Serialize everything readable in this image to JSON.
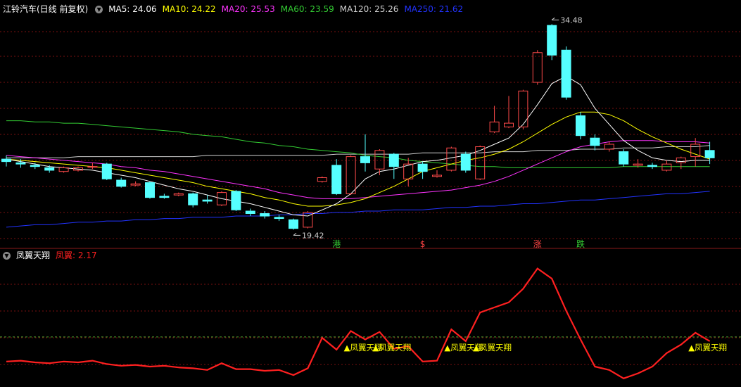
{
  "main_header": {
    "title": "江铃汽车(日线 前复权)",
    "ma": [
      {
        "label": "MA5: 24.06",
        "color": "#ffffff"
      },
      {
        "label": "MA10: 24.22",
        "color": "#ffff00"
      },
      {
        "label": "MA20: 25.53",
        "color": "#ff33ff"
      },
      {
        "label": "MA60: 23.59",
        "color": "#33cc33"
      },
      {
        "label": "MA120: 25.26",
        "color": "#cfcfcf"
      },
      {
        "label": "MA250: 21.62",
        "color": "#2233ff"
      }
    ]
  },
  "sub_header": {
    "title": "凤翼天翔",
    "value_label": "凤翼: 2.17",
    "value_color": "#ff2020"
  },
  "colors": {
    "up": "#ff4a4a",
    "down": "#55ffff",
    "ma5": "#ffffff",
    "ma10": "#ffff00",
    "ma20": "#ff33ff",
    "ma60": "#33cc33",
    "ma120": "#cfcfcf",
    "ma250": "#2233ff",
    "grid": "#7a1010",
    "signal": "#ffff00",
    "indicator": "#ff2020",
    "threshold": "#55aa33"
  },
  "chart_data": [
    {
      "type": "candlestick",
      "title": "江铃汽车(日线 前复权)",
      "ylim": [
        17.5,
        35.8
      ],
      "candles": [
        {
          "o": 24.2,
          "c": 24.0,
          "h": 24.5,
          "l": 23.6
        },
        {
          "o": 23.9,
          "c": 23.8,
          "h": 24.2,
          "l": 23.5
        },
        {
          "o": 23.7,
          "c": 23.6,
          "h": 23.9,
          "l": 23.4
        },
        {
          "o": 23.5,
          "c": 23.3,
          "h": 23.7,
          "l": 23.1
        },
        {
          "o": 23.2,
          "c": 23.5,
          "h": 23.6,
          "l": 23.1
        },
        {
          "o": 23.3,
          "c": 23.5,
          "h": 23.6,
          "l": 23.2
        },
        {
          "o": 23.6,
          "c": 23.6,
          "h": 23.9,
          "l": 23.4
        },
        {
          "o": 23.8,
          "c": 22.6,
          "h": 23.9,
          "l": 22.5
        },
        {
          "o": 22.5,
          "c": 22.0,
          "h": 22.7,
          "l": 21.9
        },
        {
          "o": 22.1,
          "c": 22.2,
          "h": 22.4,
          "l": 22.0
        },
        {
          "o": 22.3,
          "c": 21.1,
          "h": 22.4,
          "l": 21.0
        },
        {
          "o": 21.2,
          "c": 21.1,
          "h": 21.4,
          "l": 21.0
        },
        {
          "o": 21.3,
          "c": 21.4,
          "h": 21.5,
          "l": 21.2
        },
        {
          "o": 21.4,
          "c": 20.5,
          "h": 21.5,
          "l": 20.3
        },
        {
          "o": 20.9,
          "c": 20.8,
          "h": 21.3,
          "l": 20.6
        },
        {
          "o": 20.5,
          "c": 21.5,
          "h": 21.6,
          "l": 20.4
        },
        {
          "o": 21.6,
          "c": 20.1,
          "h": 21.7,
          "l": 20.0
        },
        {
          "o": 20.0,
          "c": 19.8,
          "h": 20.2,
          "l": 19.6
        },
        {
          "o": 19.8,
          "c": 19.6,
          "h": 20.0,
          "l": 19.4
        },
        {
          "o": 19.5,
          "c": 19.4,
          "h": 19.7,
          "l": 19.2
        },
        {
          "o": 19.3,
          "c": 18.6,
          "h": 19.4,
          "l": 18.5
        },
        {
          "o": 18.7,
          "c": 19.9,
          "h": 20.0,
          "l": 18.6
        },
        {
          "o": 22.4,
          "c": 22.7,
          "h": 22.8,
          "l": 22.3
        },
        {
          "o": 23.7,
          "c": 21.4,
          "h": 24.2,
          "l": 21.3
        },
        {
          "o": 21.4,
          "c": 24.4,
          "h": 24.5,
          "l": 21.3
        },
        {
          "o": 24.4,
          "c": 23.9,
          "h": 26.2,
          "l": 23.2
        },
        {
          "o": 23.4,
          "c": 24.9,
          "h": 25.0,
          "l": 22.9
        },
        {
          "o": 24.6,
          "c": 23.6,
          "h": 24.7,
          "l": 22.6
        },
        {
          "o": 22.6,
          "c": 23.8,
          "h": 24.3,
          "l": 22.0
        },
        {
          "o": 23.8,
          "c": 23.2,
          "h": 24.0,
          "l": 22.6
        },
        {
          "o": 22.8,
          "c": 22.9,
          "h": 23.3,
          "l": 22.7
        },
        {
          "o": 23.3,
          "c": 25.1,
          "h": 25.2,
          "l": 23.2
        },
        {
          "o": 24.6,
          "c": 23.3,
          "h": 24.8,
          "l": 23.1
        },
        {
          "o": 22.6,
          "c": 25.2,
          "h": 25.3,
          "l": 22.5
        },
        {
          "o": 26.4,
          "c": 27.2,
          "h": 28.5,
          "l": 26.3
        },
        {
          "o": 26.8,
          "c": 27.1,
          "h": 29.3,
          "l": 26.7
        },
        {
          "o": 26.8,
          "c": 29.7,
          "h": 29.8,
          "l": 26.6
        },
        {
          "o": 30.4,
          "c": 32.8,
          "h": 33.0,
          "l": 30.2
        },
        {
          "o": 35.0,
          "c": 32.6,
          "h": 35.1,
          "l": 32.2
        },
        {
          "o": 33.0,
          "c": 29.2,
          "h": 33.3,
          "l": 29.0
        },
        {
          "o": 27.7,
          "c": 26.1,
          "h": 28.0,
          "l": 25.8
        },
        {
          "o": 25.9,
          "c": 25.3,
          "h": 26.2,
          "l": 24.9
        },
        {
          "o": 25.0,
          "c": 25.4,
          "h": 25.6,
          "l": 24.8
        },
        {
          "o": 24.8,
          "c": 23.8,
          "h": 25.0,
          "l": 23.6
        },
        {
          "o": 23.7,
          "c": 23.8,
          "h": 24.2,
          "l": 23.5
        },
        {
          "o": 23.7,
          "c": 23.6,
          "h": 23.9,
          "l": 23.4
        },
        {
          "o": 23.3,
          "c": 23.8,
          "h": 24.1,
          "l": 23.2
        },
        {
          "o": 23.9,
          "c": 24.3,
          "h": 24.4,
          "l": 23.4
        },
        {
          "o": 24.4,
          "c": 25.4,
          "h": 25.9,
          "l": 23.6
        },
        {
          "o": 24.9,
          "c": 24.3,
          "h": 25.6,
          "l": 23.8
        }
      ],
      "ma_lines": {
        "ma5": [
          24.2,
          24.0,
          23.8,
          23.6,
          23.5,
          23.4,
          23.3,
          23.1,
          22.9,
          22.7,
          22.4,
          22.1,
          21.8,
          21.6,
          21.3,
          21.0,
          20.8,
          20.6,
          20.3,
          20.0,
          19.7,
          19.6,
          20.1,
          20.6,
          21.4,
          22.6,
          23.2,
          23.4,
          23.7,
          24.0,
          24.1,
          24.3,
          24.5,
          24.9,
          25.4,
          25.9,
          27.0,
          28.6,
          30.3,
          30.9,
          30.2,
          28.3,
          27.0,
          25.7,
          24.9,
          24.3,
          24.1,
          24.0,
          24.1,
          24.1
        ],
        "ma10": [
          24.2,
          24.1,
          24.0,
          23.9,
          23.8,
          23.7,
          23.6,
          23.5,
          23.3,
          23.1,
          22.9,
          22.7,
          22.5,
          22.3,
          22.0,
          21.8,
          21.6,
          21.4,
          21.1,
          20.9,
          20.6,
          20.4,
          20.4,
          20.5,
          20.7,
          21.0,
          21.5,
          22.0,
          22.6,
          23.2,
          23.5,
          23.8,
          24.1,
          24.3,
          24.6,
          25.0,
          25.6,
          26.3,
          27.0,
          27.6,
          28.0,
          28.0,
          27.8,
          27.3,
          26.6,
          26.0,
          25.5,
          25.0,
          24.6,
          24.2
        ],
        "ma20": [
          24.5,
          24.4,
          24.3,
          24.2,
          24.1,
          24.0,
          23.9,
          23.8,
          23.6,
          23.5,
          23.3,
          23.2,
          23.0,
          22.8,
          22.6,
          22.4,
          22.2,
          22.0,
          21.8,
          21.5,
          21.3,
          21.1,
          21.0,
          21.0,
          21.0,
          21.1,
          21.2,
          21.3,
          21.4,
          21.5,
          21.6,
          21.7,
          21.9,
          22.1,
          22.4,
          22.8,
          23.3,
          23.8,
          24.3,
          24.8,
          25.2,
          25.4,
          25.6,
          25.7,
          25.7,
          25.7,
          25.6,
          25.6,
          25.6,
          25.5
        ],
        "ma60": [
          27.3,
          27.3,
          27.2,
          27.2,
          27.1,
          27.1,
          27.0,
          26.9,
          26.8,
          26.7,
          26.6,
          26.5,
          26.4,
          26.2,
          26.1,
          26.0,
          25.8,
          25.6,
          25.5,
          25.3,
          25.2,
          25.0,
          24.9,
          24.8,
          24.7,
          24.5,
          24.4,
          24.3,
          24.1,
          24.0,
          23.9,
          23.8,
          23.7,
          23.6,
          23.6,
          23.5,
          23.5,
          23.5,
          23.5,
          23.5,
          23.5,
          23.5,
          23.5,
          23.6,
          23.6,
          23.6,
          23.6,
          23.6,
          23.6,
          23.6
        ],
        "ma120": [
          24.3,
          24.3,
          24.3,
          24.3,
          24.3,
          24.4,
          24.4,
          24.4,
          24.4,
          24.4,
          24.4,
          24.4,
          24.4,
          24.4,
          24.5,
          24.5,
          24.5,
          24.5,
          24.5,
          24.5,
          24.5,
          24.5,
          24.5,
          24.6,
          24.6,
          24.6,
          24.6,
          24.6,
          24.6,
          24.7,
          24.7,
          24.7,
          24.7,
          24.7,
          24.8,
          24.8,
          24.8,
          24.9,
          24.9,
          24.9,
          25.0,
          25.0,
          25.0,
          25.1,
          25.1,
          25.1,
          25.2,
          25.2,
          25.2,
          25.3
        ],
        "ma250": [
          18.7,
          18.8,
          18.9,
          18.9,
          19.0,
          19.1,
          19.1,
          19.2,
          19.2,
          19.3,
          19.3,
          19.4,
          19.4,
          19.5,
          19.5,
          19.5,
          19.6,
          19.6,
          19.6,
          19.7,
          19.7,
          19.8,
          19.8,
          19.9,
          19.9,
          20.0,
          20.0,
          20.1,
          20.1,
          20.1,
          20.2,
          20.3,
          20.3,
          20.4,
          20.4,
          20.5,
          20.6,
          20.6,
          20.7,
          20.8,
          20.9,
          20.9,
          21.0,
          21.1,
          21.2,
          21.3,
          21.4,
          21.4,
          21.5,
          21.6
        ]
      },
      "annotations": [
        {
          "text": "34.48",
          "index": 38,
          "kind": "high"
        },
        {
          "text": "19.42",
          "index": 20,
          "kind": "low"
        }
      ],
      "markers": [
        {
          "text": "港",
          "index": 23,
          "color": "#33cc33"
        },
        {
          "text": "$",
          "index": 29,
          "color": "#ff4444"
        },
        {
          "text": "涨",
          "index": 37,
          "color": "#ff4444"
        },
        {
          "text": "跌",
          "index": 40,
          "color": "#33cc33"
        }
      ]
    },
    {
      "type": "line",
      "title": "凤翼天翔",
      "series": [
        {
          "name": "凤翼",
          "values": [
            1.3,
            1.35,
            1.25,
            1.2,
            1.3,
            1.25,
            1.35,
            1.15,
            1.05,
            1.1,
            1.0,
            1.05,
            0.95,
            0.9,
            0.8,
            1.2,
            0.85,
            0.85,
            0.75,
            0.8,
            0.5,
            0.9,
            2.7,
            2.0,
            3.1,
            2.6,
            3.05,
            2.05,
            2.2,
            1.3,
            1.35,
            3.2,
            2.5,
            4.2,
            4.5,
            4.8,
            5.6,
            6.8,
            6.2,
            4.3,
            2.6,
            1.0,
            0.8,
            0.3,
            0.6,
            1.0,
            1.8,
            2.3,
            3.0,
            2.5
          ]
        }
      ],
      "ylim": [
        0,
        7.2
      ],
      "threshold": 2.75,
      "signals": [
        {
          "index": 24,
          "text": "▲凤翼天翔"
        },
        {
          "index": 26,
          "text": "▲凤翼天翔"
        },
        {
          "index": 31,
          "text": "▲凤翼天翔"
        },
        {
          "index": 33,
          "text": "▲凤翼天翔"
        },
        {
          "index": 48,
          "text": "▲凤翼天翔"
        }
      ]
    }
  ]
}
